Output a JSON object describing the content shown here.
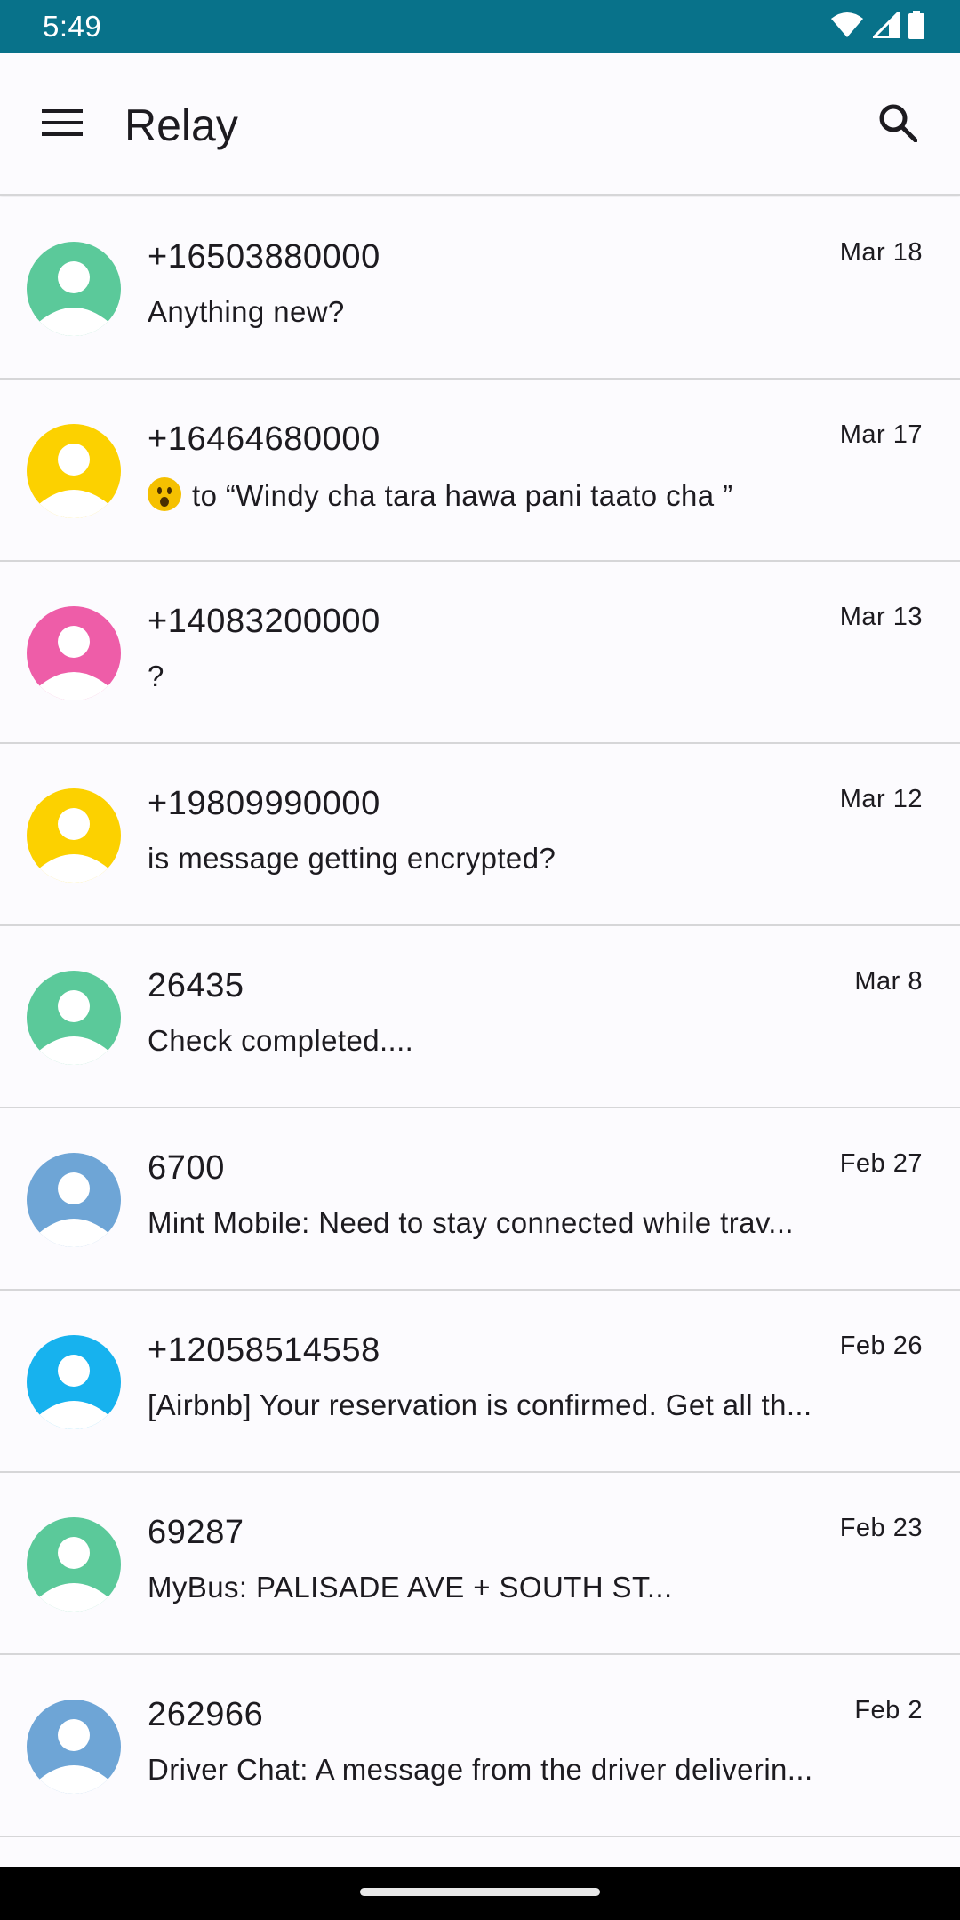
{
  "status_bar": {
    "time": "5:49",
    "icons": [
      "wifi-icon",
      "signal-icon",
      "battery-icon"
    ]
  },
  "app_bar": {
    "title": "Relay",
    "menu_icon": "menu-icon",
    "search_icon": "search-icon"
  },
  "colors": {
    "status_bar": "#08728a",
    "divider": "#d6d6d8",
    "background": "#fcfbfe"
  },
  "conversations": [
    {
      "name": "+16503880000",
      "date": "Mar 18",
      "preview": "Anything new?",
      "avatar_color": "#5bc99a"
    },
    {
      "name": "+16464680000",
      "date": "Mar 17",
      "preview": "to “Windy cha tara hawa pani taato cha ”",
      "avatar_color": "#fcd100",
      "reaction": "surprised-face-emoji"
    },
    {
      "name": "+14083200000",
      "date": "Mar 13",
      "preview": "?",
      "avatar_color": "#ee5da8"
    },
    {
      "name": "+19809990000",
      "date": "Mar 12",
      "preview": "is message getting encrypted?",
      "avatar_color": "#fcd100"
    },
    {
      "name": "26435",
      "date": "Mar 8",
      "preview": "Check completed....",
      "avatar_color": "#5bc99a"
    },
    {
      "name": "6700",
      "date": "Feb 27",
      "preview": "Mint Mobile: Need to stay connected while trav...",
      "avatar_color": "#6ea5d6"
    },
    {
      "name": "+12058514558",
      "date": "Feb 26",
      "preview": "[Airbnb] Your reservation is confirmed. Get all th...",
      "avatar_color": "#17b2ee"
    },
    {
      "name": "69287",
      "date": "Feb 23",
      "preview": "MyBus: PALISADE AVE + SOUTH ST...",
      "avatar_color": "#5bc99a"
    },
    {
      "name": "262966",
      "date": "Feb 2",
      "preview": "Driver Chat: A message from the driver deliverin...",
      "avatar_color": "#6ea5d6"
    }
  ]
}
